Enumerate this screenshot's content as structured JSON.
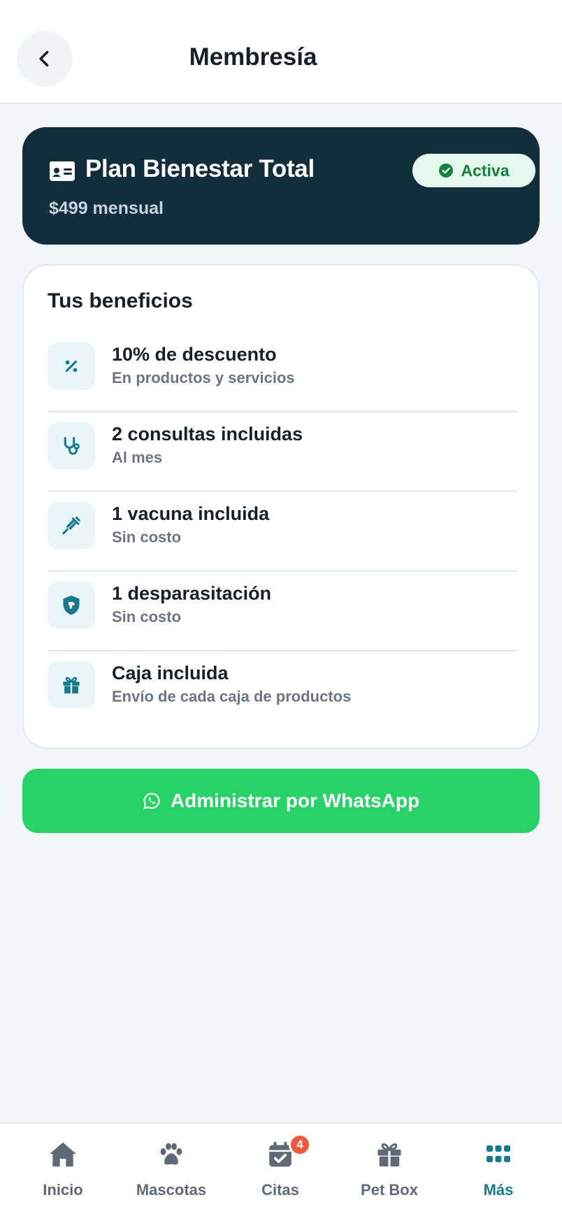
{
  "header": {
    "title": "Membresía"
  },
  "plan": {
    "name": "Plan Bienestar Total",
    "price": "$499 mensual",
    "status": "Activa"
  },
  "benefits": {
    "title": "Tus beneficios",
    "items": [
      {
        "icon": "percent-icon",
        "title": "10% de descuento",
        "subtitle": "En productos y servicios"
      },
      {
        "icon": "stethoscope-icon",
        "title": "2 consultas incluidas",
        "subtitle": "Al mes"
      },
      {
        "icon": "syringe-icon",
        "title": "1 vacuna incluida",
        "subtitle": "Sin costo"
      },
      {
        "icon": "shield-dog-icon",
        "title": "1 desparasitación",
        "subtitle": "Sin costo"
      },
      {
        "icon": "gift-icon",
        "title": "Caja incluida",
        "subtitle": "Envío de cada caja de productos"
      }
    ]
  },
  "whatsapp_button": {
    "label": "Administrar por WhatsApp"
  },
  "nav": {
    "items": [
      {
        "label": "Inicio",
        "icon": "home-icon"
      },
      {
        "label": "Mascotas",
        "icon": "paw-icon"
      },
      {
        "label": "Citas",
        "icon": "calendar-check-icon",
        "badge": "4"
      },
      {
        "label": "Pet Box",
        "icon": "gift-icon"
      },
      {
        "label": "Más",
        "icon": "grid-icon",
        "active": true
      }
    ]
  },
  "colors": {
    "plan_card_bg": "#122d3c",
    "accent": "#147a8f",
    "whatsapp": "#27d366",
    "status_green": "#14823f",
    "badge_red": "#ef5a3c"
  }
}
